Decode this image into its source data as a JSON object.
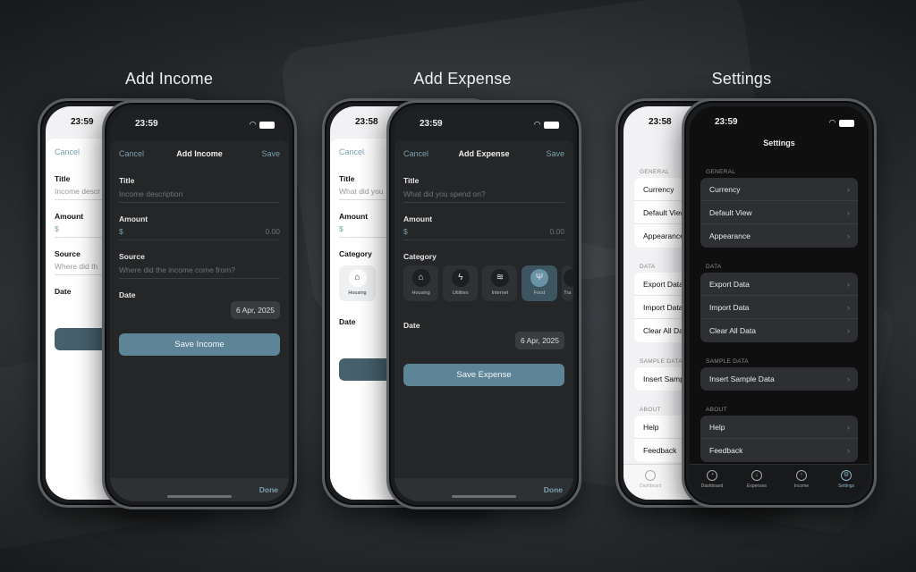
{
  "titles": {
    "income": "Add Income",
    "expense": "Add Expense",
    "settings": "Settings"
  },
  "common": {
    "cancel": "Cancel",
    "save": "Save",
    "done": "Done",
    "currency_symbol": "$",
    "amount_placeholder": "0.00"
  },
  "income_back": {
    "time": "23:59",
    "cancel": "Cancel",
    "title_label": "Title",
    "title_placeholder": "Income descr",
    "amount_label": "Amount",
    "source_label": "Source",
    "source_placeholder": "Where did th",
    "date_label": "Date"
  },
  "income_front": {
    "time": "23:59",
    "nav_title": "Add Income",
    "title_label": "Title",
    "title_placeholder": "Income description",
    "amount_label": "Amount",
    "source_label": "Source",
    "source_placeholder": "Where did the income come from?",
    "date_label": "Date",
    "date_value": "6 Apr, 2025",
    "save_button": "Save Income"
  },
  "expense_back": {
    "time": "23:58",
    "title_placeholder": "What did you",
    "category_label": "Category",
    "category": "Housing",
    "date_label": "Date"
  },
  "expense_front": {
    "time": "23:59",
    "nav_title": "Add Expense",
    "title_label": "Title",
    "title_placeholder": "What did you spend on?",
    "amount_label": "Amount",
    "category_label": "Category",
    "categories": [
      {
        "label": "Housing",
        "icon": "house-icon"
      },
      {
        "label": "Utilities",
        "icon": "bolt-icon"
      },
      {
        "label": "Internet",
        "icon": "wifi-icon"
      },
      {
        "label": "Food",
        "icon": "fork-knife-icon",
        "selected": true
      },
      {
        "label": "Tra",
        "icon": "car-icon"
      }
    ],
    "date_label": "Date",
    "date_value": "6 Apr, 2025",
    "save_button": "Save Expense"
  },
  "settings_back": {
    "time": "23:58",
    "general": "GENERAL",
    "data": "DATA",
    "sample": "SAMPLE DATA",
    "about": "ABOUT",
    "rows_general": [
      "Currency",
      "Default View",
      "Appearance"
    ],
    "rows_data": [
      "Export Data",
      "Import Data",
      "Clear All Dat"
    ],
    "rows_sample": [
      "Insert Sampl"
    ],
    "rows_about": [
      "Help",
      "Feedback"
    ],
    "tab": "Dashboard"
  },
  "settings_front": {
    "time": "23:59",
    "nav_title": "Settings",
    "general": "GENERAL",
    "data": "DATA",
    "sample": "SAMPLE DATA",
    "about": "ABOUT",
    "rows_general": [
      "Currency",
      "Default View",
      "Appearance"
    ],
    "rows_data": [
      "Export Data",
      "Import Data",
      "Clear All Data"
    ],
    "rows_sample": [
      "Insert Sample Data"
    ],
    "rows_about": [
      "Help",
      "Feedback"
    ],
    "tabs": [
      "Dashboard",
      "Expenses",
      "Income",
      "Settings"
    ]
  }
}
